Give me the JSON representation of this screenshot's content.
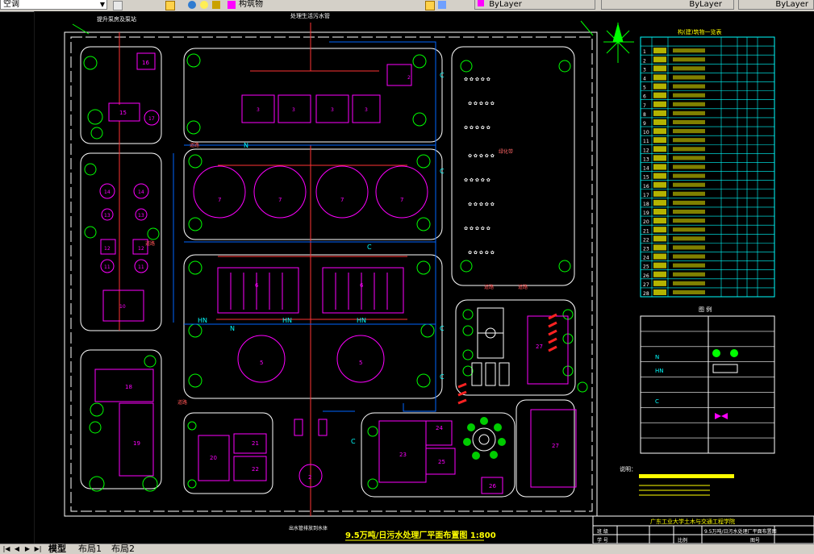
{
  "toolbar": {
    "layer_name": "空调",
    "layer_value": "构筑物",
    "color_value": "ByLayer",
    "linetype_value": "ByLayer",
    "lineweight_value": "ByLayer"
  },
  "drawing": {
    "title": "9.5万吨/日污水处理厂平面布置图 1:800",
    "label_top_left": "提升泵房及泵站",
    "label_top_center": "处理生活污水管",
    "label_bottom_center": "出水管排放到水体",
    "road_labels": [
      "道路",
      "道路",
      "道路",
      "道路",
      "道路"
    ],
    "green_label": "绿化带",
    "units": [
      "1",
      "2",
      "3",
      "4",
      "5",
      "6",
      "7",
      "8",
      "9",
      "10",
      "11",
      "12",
      "13",
      "14",
      "15",
      "16",
      "17",
      "18",
      "19",
      "20",
      "21",
      "22",
      "23",
      "24",
      "25",
      "26",
      "27"
    ],
    "pipe_letters": {
      "c": "C",
      "n": "N",
      "hn": "HN"
    }
  },
  "table_main": {
    "title": "构(建)筑物一览表",
    "rows": [
      "1",
      "2",
      "3",
      "4",
      "5",
      "6",
      "7",
      "8",
      "9",
      "10",
      "11",
      "12",
      "13",
      "14",
      "15",
      "16",
      "17",
      "18",
      "19",
      "20",
      "21",
      "22",
      "23",
      "24",
      "25",
      "26",
      "27",
      "28"
    ]
  },
  "legend": {
    "title": "图 例",
    "n_label": "N",
    "hn_label": "HN",
    "c_label": "C"
  },
  "notes": {
    "title": "说明："
  },
  "title_block": {
    "school": "广东工业大学土木与交通工程学院",
    "drawing_name": "9.5万吨/日污水处理厂平面布置图",
    "scale_label": "比例",
    "sheet_label": "图号",
    "row1_a": "班 级",
    "row2_a": "学 号"
  },
  "tabs": [
    "模型",
    "布局1",
    "布局2"
  ]
}
